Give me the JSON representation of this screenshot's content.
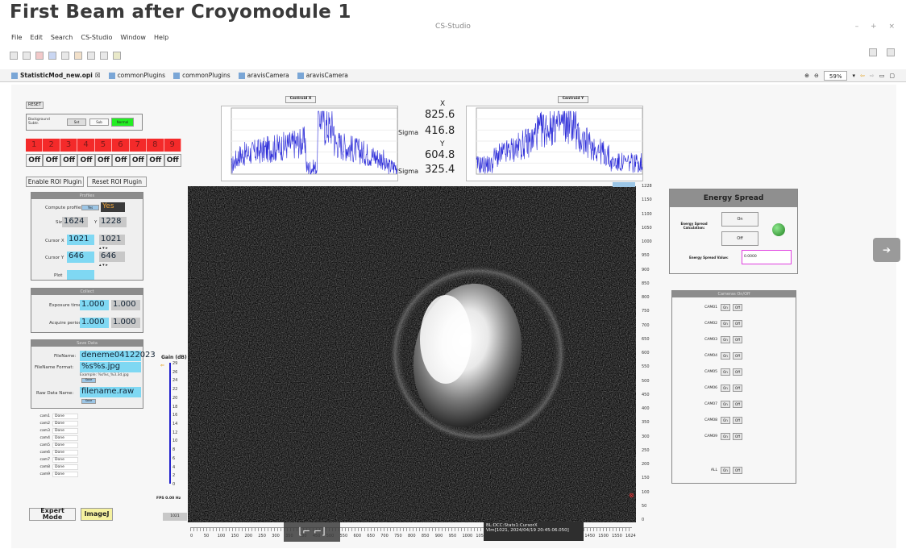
{
  "slide_title": "First Beam after Croyomodule 1",
  "app_title": "CS-Studio",
  "window_controls": "– + ×",
  "menu": [
    "File",
    "Edit",
    "Search",
    "CS-Studio",
    "Window",
    "Help"
  ],
  "tabs": [
    {
      "label": "StatisticMod_new.opi",
      "active": true
    },
    {
      "label": "commonPlugins",
      "active": false
    },
    {
      "label": "commonPlugins",
      "active": false
    },
    {
      "label": "aravisCamera",
      "active": false
    },
    {
      "label": "aravisCamera",
      "active": false
    }
  ],
  "tab_close": "☒",
  "zoom": "59%",
  "left": {
    "reset_label": "RESET",
    "background": {
      "label": "Background Subtr.",
      "set": "Set",
      "sub": "Sub",
      "status": "Normal"
    },
    "roi_numbers": [
      "1",
      "2",
      "3",
      "4",
      "5",
      "6",
      "7",
      "8",
      "9"
    ],
    "roi_states": [
      "Off",
      "Off",
      "Off",
      "Off",
      "Off",
      "Off",
      "Off",
      "Off",
      "Off"
    ],
    "enable_roi": "Enable ROI Plugin",
    "reset_roi": "Reset ROI Plugin",
    "profiles": {
      "title": "Profiles",
      "compute_label": "Compute profiles",
      "compute_btn": "Yes",
      "compute_val": "Yes",
      "size_x_label": "Size X",
      "size_x": "1624",
      "y_label": "Y",
      "size_y": "1228",
      "cursor_x_label": "Cursor X",
      "cursor_x_set": "1021",
      "cursor_x_rb": "1021",
      "cursor_y_label": "Cursor Y",
      "cursor_y_set": "646",
      "cursor_y_rb": "646",
      "plot_label": "Plot"
    },
    "collect": {
      "title": "Collect",
      "exposure_label": "Exposure time",
      "exposure_set": "1.000",
      "exposure_rb": "1.000",
      "acquire_label": "Acquire period",
      "acquire_set": "1.000",
      "acquire_rb": "1.000"
    },
    "save": {
      "title": "Save Data",
      "filename_label": "FileName:",
      "filename": "deneme04122023",
      "format_label": "FileName Format:",
      "format": "%s%s.jpg",
      "example": "Example: %s%s_%3.3d.jpg",
      "save_btn": "Save",
      "raw_label": "Raw Data Name:",
      "raw": "filename.raw",
      "save_btn2": "Save"
    },
    "cams": [
      {
        "name": "cam1",
        "status": "Done"
      },
      {
        "name": "cam2",
        "status": "Done"
      },
      {
        "name": "cam3",
        "status": "Done"
      },
      {
        "name": "cam4",
        "status": "Done"
      },
      {
        "name": "cam5",
        "status": "Done"
      },
      {
        "name": "cam6",
        "status": "Done"
      },
      {
        "name": "cam7",
        "status": "Done"
      },
      {
        "name": "cam8",
        "status": "Done"
      },
      {
        "name": "cam9",
        "status": "Done"
      }
    ],
    "expert_mode": "Expert Mode",
    "imagej": "ImageJ"
  },
  "gain": {
    "label": "Gain (dB)",
    "ticks": [
      "29",
      "26",
      "24",
      "22",
      "20",
      "18",
      "16",
      "14",
      "12",
      "10",
      "8",
      "6",
      "4",
      "2",
      "0"
    ],
    "fps": "FPS 0.00 Hz",
    "value_box": "1021"
  },
  "profiles_top": {
    "centroid_x_title": "Centroid X",
    "centroid_y_title": "Centroid Y",
    "x_label": "X",
    "x_val": "825.6",
    "sigma_label": "Sigma",
    "sigma_x": "416.8",
    "y_label": "Y",
    "y_val": "604.8",
    "sigma_y": "325.4"
  },
  "image": {
    "right_ticks": [
      "1228",
      "1150",
      "1100",
      "1050",
      "1000",
      "950",
      "900",
      "850",
      "800",
      "750",
      "700",
      "650",
      "600",
      "550",
      "500",
      "450",
      "400",
      "350",
      "300",
      "250",
      "200",
      "150",
      "100",
      "50",
      "0"
    ],
    "bottom_ticks": [
      "0",
      "50",
      "100",
      "150",
      "200",
      "250",
      "300",
      "350",
      "400",
      "450",
      "500",
      "550",
      "600",
      "650",
      "700",
      "750",
      "800",
      "850",
      "900",
      "950",
      "1000",
      "1050",
      "1100",
      "1150",
      "1200",
      "1250",
      "1300",
      "1350",
      "1400",
      "1450",
      "1500",
      "1550",
      "1624"
    ],
    "tooltip_line1": "BL:DCC:Stats1:CursorX",
    "tooltip_line2": "Vlm[1021, 2024/04/19 20:45:06.050]"
  },
  "energy": {
    "title": "Energy Spread",
    "calc_label": "Energy Spread Calculation:",
    "on": "On",
    "off": "Off",
    "value_label": "Energy Spread Value:",
    "value": "0.0000"
  },
  "cameras": {
    "title": "Cameras On/Off",
    "rows": [
      "CAM01",
      "CAM02",
      "CAM03",
      "CAM04",
      "CAM05",
      "CAM06",
      "CAM07",
      "CAM08",
      "CAM09"
    ],
    "all": "ALL",
    "on": "On",
    "off": "Off"
  },
  "colors": {
    "red": "#f42a2a",
    "green": "#22ee22",
    "cyan": "#7fd8f3",
    "plot_line": "#2b2bd8"
  }
}
